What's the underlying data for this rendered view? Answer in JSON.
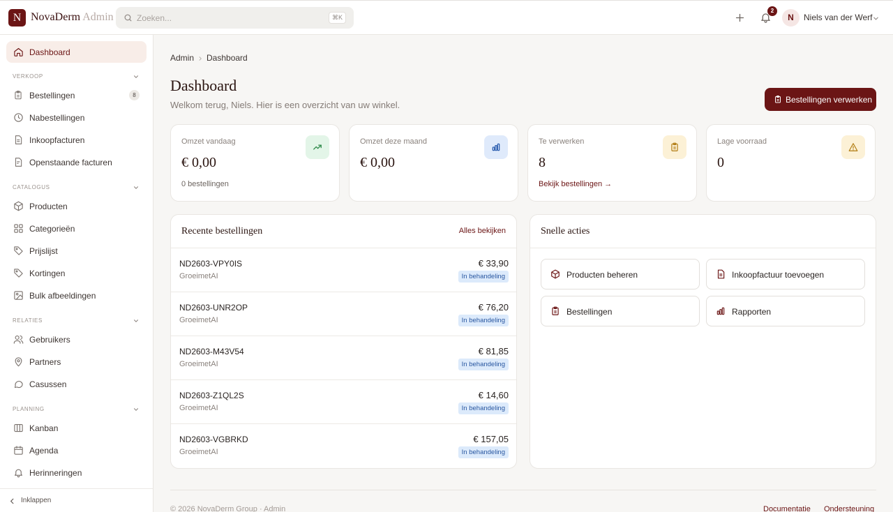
{
  "brand": {
    "initial": "N",
    "name": "NovaDerm",
    "suffix": "Admin"
  },
  "search": {
    "placeholder": "Zoeken...",
    "shortcut": "⌘K"
  },
  "topbar": {
    "notifications_count": "2",
    "user_initial": "N",
    "user_name": "Niels van der Werf"
  },
  "sidebar": {
    "dashboard": "Dashboard",
    "sections": {
      "verkoop": {
        "title": "VERKOOP",
        "items": [
          "Bestellingen",
          "Nabestellingen",
          "Inkoopfacturen",
          "Openstaande facturen"
        ],
        "orders_count": "8"
      },
      "catalogus": {
        "title": "CATALOGUS",
        "items": [
          "Producten",
          "Categorieën",
          "Prijslijst",
          "Kortingen",
          "Bulk afbeeldingen"
        ]
      },
      "relaties": {
        "title": "RELATIES",
        "items": [
          "Gebruikers",
          "Partners",
          "Casussen"
        ]
      },
      "planning": {
        "title": "PLANNING",
        "items": [
          "Kanban",
          "Agenda",
          "Herinneringen"
        ]
      }
    },
    "collapse": "Inklappen"
  },
  "breadcrumb": [
    "Admin",
    "Dashboard"
  ],
  "page": {
    "title": "Dashboard",
    "subtitle": "Welkom terug, Niels. Hier is een overzicht van uw winkel.",
    "primary_action": "Bestellingen verwerken"
  },
  "stats": [
    {
      "label": "Omzet vandaag",
      "value": "€ 0,00",
      "foot": "0 bestellingen",
      "icon": "trending-up-icon",
      "accent": "#e3f5e8"
    },
    {
      "label": "Omzet deze maand",
      "value": "€ 0,00",
      "foot": "",
      "icon": "bar-chart-icon",
      "accent": "#dfeafb"
    },
    {
      "label": "Te verwerken",
      "value": "8",
      "foot": "Bekijk bestellingen →",
      "icon": "clipboard-icon",
      "accent": "#fcf1d6"
    },
    {
      "label": "Lage voorraad",
      "value": "0",
      "foot": "",
      "icon": "warning-icon",
      "accent": "#fcf1d6"
    }
  ],
  "recent_orders": {
    "title": "Recente bestellingen",
    "view_all": "Alles bekijken",
    "rows": [
      {
        "id": "ND2603-VPY0IS",
        "customer": "GroeimetAI",
        "amount": "€ 33,90",
        "status": "In behandeling"
      },
      {
        "id": "ND2603-UNR2OP",
        "customer": "GroeimetAI",
        "amount": "€ 76,20",
        "status": "In behandeling"
      },
      {
        "id": "ND2603-M43V54",
        "customer": "GroeimetAI",
        "amount": "€ 81,85",
        "status": "In behandeling"
      },
      {
        "id": "ND2603-Z1QL2S",
        "customer": "GroeimetAI",
        "amount": "€ 14,60",
        "status": "In behandeling"
      },
      {
        "id": "ND2603-VGBRKD",
        "customer": "GroeimetAI",
        "amount": "€ 157,05",
        "status": "In behandeling"
      }
    ]
  },
  "quick_actions": {
    "title": "Snelle acties",
    "items": [
      "Producten beheren",
      "Inkoopfactuur toevoegen",
      "Bestellingen",
      "Rapporten"
    ]
  },
  "footer": {
    "copyright": "© 2026 NovaDerm Group · Admin",
    "links": [
      "Documentatie",
      "Ondersteuning"
    ]
  },
  "colors": {
    "brand": "#6b1515",
    "active_bg": "#f8ede8",
    "badge_bg": "#dceafb",
    "badge_text": "#2856a0"
  }
}
